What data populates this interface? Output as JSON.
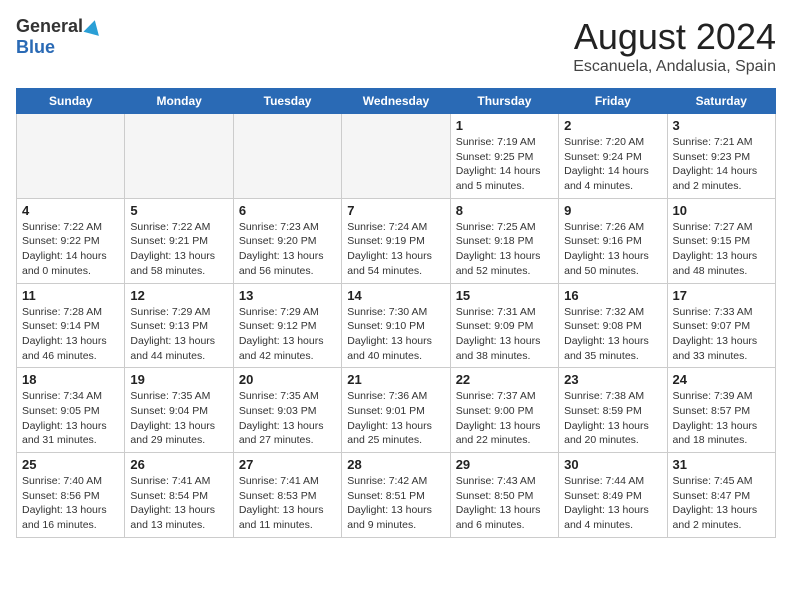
{
  "header": {
    "logo_general": "General",
    "logo_blue": "Blue",
    "month_title": "August 2024",
    "location": "Escanuela, Andalusia, Spain"
  },
  "days_of_week": [
    "Sunday",
    "Monday",
    "Tuesday",
    "Wednesday",
    "Thursday",
    "Friday",
    "Saturday"
  ],
  "weeks": [
    [
      {
        "day": "",
        "info": ""
      },
      {
        "day": "",
        "info": ""
      },
      {
        "day": "",
        "info": ""
      },
      {
        "day": "",
        "info": ""
      },
      {
        "day": "1",
        "info": "Sunrise: 7:19 AM\nSunset: 9:25 PM\nDaylight: 14 hours\nand 5 minutes."
      },
      {
        "day": "2",
        "info": "Sunrise: 7:20 AM\nSunset: 9:24 PM\nDaylight: 14 hours\nand 4 minutes."
      },
      {
        "day": "3",
        "info": "Sunrise: 7:21 AM\nSunset: 9:23 PM\nDaylight: 14 hours\nand 2 minutes."
      }
    ],
    [
      {
        "day": "4",
        "info": "Sunrise: 7:22 AM\nSunset: 9:22 PM\nDaylight: 14 hours\nand 0 minutes."
      },
      {
        "day": "5",
        "info": "Sunrise: 7:22 AM\nSunset: 9:21 PM\nDaylight: 13 hours\nand 58 minutes."
      },
      {
        "day": "6",
        "info": "Sunrise: 7:23 AM\nSunset: 9:20 PM\nDaylight: 13 hours\nand 56 minutes."
      },
      {
        "day": "7",
        "info": "Sunrise: 7:24 AM\nSunset: 9:19 PM\nDaylight: 13 hours\nand 54 minutes."
      },
      {
        "day": "8",
        "info": "Sunrise: 7:25 AM\nSunset: 9:18 PM\nDaylight: 13 hours\nand 52 minutes."
      },
      {
        "day": "9",
        "info": "Sunrise: 7:26 AM\nSunset: 9:16 PM\nDaylight: 13 hours\nand 50 minutes."
      },
      {
        "day": "10",
        "info": "Sunrise: 7:27 AM\nSunset: 9:15 PM\nDaylight: 13 hours\nand 48 minutes."
      }
    ],
    [
      {
        "day": "11",
        "info": "Sunrise: 7:28 AM\nSunset: 9:14 PM\nDaylight: 13 hours\nand 46 minutes."
      },
      {
        "day": "12",
        "info": "Sunrise: 7:29 AM\nSunset: 9:13 PM\nDaylight: 13 hours\nand 44 minutes."
      },
      {
        "day": "13",
        "info": "Sunrise: 7:29 AM\nSunset: 9:12 PM\nDaylight: 13 hours\nand 42 minutes."
      },
      {
        "day": "14",
        "info": "Sunrise: 7:30 AM\nSunset: 9:10 PM\nDaylight: 13 hours\nand 40 minutes."
      },
      {
        "day": "15",
        "info": "Sunrise: 7:31 AM\nSunset: 9:09 PM\nDaylight: 13 hours\nand 38 minutes."
      },
      {
        "day": "16",
        "info": "Sunrise: 7:32 AM\nSunset: 9:08 PM\nDaylight: 13 hours\nand 35 minutes."
      },
      {
        "day": "17",
        "info": "Sunrise: 7:33 AM\nSunset: 9:07 PM\nDaylight: 13 hours\nand 33 minutes."
      }
    ],
    [
      {
        "day": "18",
        "info": "Sunrise: 7:34 AM\nSunset: 9:05 PM\nDaylight: 13 hours\nand 31 minutes."
      },
      {
        "day": "19",
        "info": "Sunrise: 7:35 AM\nSunset: 9:04 PM\nDaylight: 13 hours\nand 29 minutes."
      },
      {
        "day": "20",
        "info": "Sunrise: 7:35 AM\nSunset: 9:03 PM\nDaylight: 13 hours\nand 27 minutes."
      },
      {
        "day": "21",
        "info": "Sunrise: 7:36 AM\nSunset: 9:01 PM\nDaylight: 13 hours\nand 25 minutes."
      },
      {
        "day": "22",
        "info": "Sunrise: 7:37 AM\nSunset: 9:00 PM\nDaylight: 13 hours\nand 22 minutes."
      },
      {
        "day": "23",
        "info": "Sunrise: 7:38 AM\nSunset: 8:59 PM\nDaylight: 13 hours\nand 20 minutes."
      },
      {
        "day": "24",
        "info": "Sunrise: 7:39 AM\nSunset: 8:57 PM\nDaylight: 13 hours\nand 18 minutes."
      }
    ],
    [
      {
        "day": "25",
        "info": "Sunrise: 7:40 AM\nSunset: 8:56 PM\nDaylight: 13 hours\nand 16 minutes."
      },
      {
        "day": "26",
        "info": "Sunrise: 7:41 AM\nSunset: 8:54 PM\nDaylight: 13 hours\nand 13 minutes."
      },
      {
        "day": "27",
        "info": "Sunrise: 7:41 AM\nSunset: 8:53 PM\nDaylight: 13 hours\nand 11 minutes."
      },
      {
        "day": "28",
        "info": "Sunrise: 7:42 AM\nSunset: 8:51 PM\nDaylight: 13 hours\nand 9 minutes."
      },
      {
        "day": "29",
        "info": "Sunrise: 7:43 AM\nSunset: 8:50 PM\nDaylight: 13 hours\nand 6 minutes."
      },
      {
        "day": "30",
        "info": "Sunrise: 7:44 AM\nSunset: 8:49 PM\nDaylight: 13 hours\nand 4 minutes."
      },
      {
        "day": "31",
        "info": "Sunrise: 7:45 AM\nSunset: 8:47 PM\nDaylight: 13 hours\nand 2 minutes."
      }
    ]
  ]
}
